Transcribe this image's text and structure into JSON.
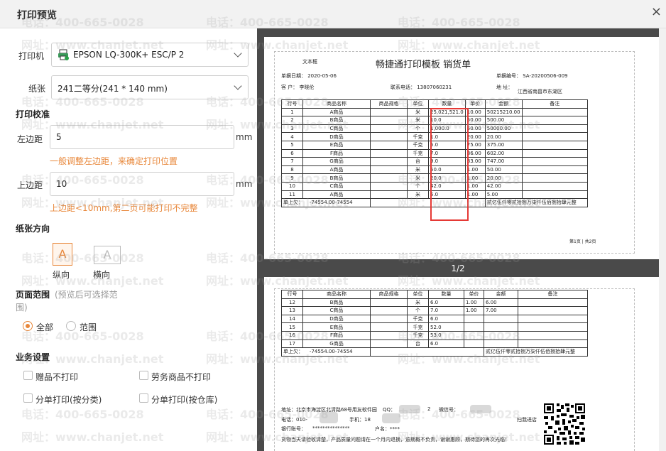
{
  "window": {
    "title": "打印预览",
    "close": "×"
  },
  "watermark": {
    "phone": "电话：400-665-0028",
    "site": "网址：www.chanjet.net"
  },
  "printer": {
    "label": "打印机",
    "value": "EPSON LQ-300K+ ESC/P 2"
  },
  "paper": {
    "label": "纸张",
    "value": "241二等分(241 * 140  mm)"
  },
  "calibration": {
    "title": "打印校准",
    "left_label": "左边距",
    "left_value": "5",
    "left_unit": "mm",
    "left_hint": "一般调整左边距，来确定打印位置",
    "top_label": "上边距",
    "top_value": "10",
    "top_unit": "mm",
    "top_hint": "上边距<10mm,第二页可能打印不完整"
  },
  "orientation": {
    "title": "纸张方向",
    "portrait": "纵向",
    "landscape": "横向",
    "glyph": "A"
  },
  "range": {
    "title": "页面范围",
    "note": "(预览后可选择范围)",
    "all": "全部",
    "custom": "范围"
  },
  "business": {
    "title": "业务设置",
    "no_gift": "赠品不打印",
    "no_service": "劳务商品不打印",
    "split_category": "分单打印(按分类)",
    "split_warehouse": "分单打印(按仓库)"
  },
  "preview": {
    "page_indicator": "1/2",
    "doc_title": "畅捷通打印模板  销货单",
    "tag": "文本框",
    "date": "单据日期： 2020-05-06",
    "customer": "客    户： 李晓伦",
    "phone": "联系电话： 13807060231",
    "bill_no": "单据编号： SA-20200506-009",
    "address": "地  址：",
    "address_value": "江西省南昌市东湖区",
    "headers": [
      "行号",
      "商品名称",
      "商品规格",
      "单位",
      "数量",
      "单价",
      "金额",
      "备注"
    ],
    "rows1": [
      [
        "1",
        "A商品",
        "",
        "米",
        "25,021,521.0",
        "10.00",
        "50215210.00"
      ],
      [
        "2",
        "B商品",
        "",
        "米",
        "10.0",
        "50.00",
        "500.00"
      ],
      [
        "3",
        "C商品",
        "",
        "个",
        "1,000.0",
        "50.00",
        "50000.00"
      ],
      [
        "4",
        "D商品",
        "",
        "千克",
        "1.0",
        "20.00",
        "20.00"
      ],
      [
        "5",
        "E商品",
        "",
        "千克",
        "5.0",
        "75.00",
        "375.00"
      ],
      [
        "6",
        "F商品",
        "",
        "千克",
        "7.0",
        "86.00",
        "602.00"
      ],
      [
        "7",
        "G商品",
        "",
        "台",
        "9.0",
        "83.00",
        "747.00"
      ],
      [
        "8",
        "A商品",
        "",
        "米",
        "50.0",
        "1.00",
        "50.00"
      ],
      [
        "9",
        "B商品",
        "",
        "米",
        "20.0",
        "1.00",
        "20.00"
      ],
      [
        "10",
        "C商品",
        "",
        "个",
        "42.0",
        "1.00",
        "42.00"
      ],
      [
        "11",
        "A商品",
        "",
        "米",
        "5.0",
        "1.00",
        "5.00"
      ]
    ],
    "rows2": [
      [
        "12",
        "B商品",
        "",
        "米",
        "6.0",
        "1.00",
        "6.00"
      ],
      [
        "13",
        "C商品",
        "",
        "个",
        "7.0",
        "1.00",
        "7.00"
      ],
      [
        "14",
        "D商品",
        "",
        "千克",
        "6.0",
        "",
        ""
      ],
      [
        "15",
        "E商品",
        "",
        "千克",
        "52.0",
        "",
        ""
      ],
      [
        "16",
        "F商品",
        "",
        "千克",
        "53.0",
        "",
        ""
      ],
      [
        "17",
        "G商品",
        "",
        "台",
        "6.0",
        "",
        ""
      ]
    ],
    "total_label": "单上欠：",
    "total_value": "-74554.00-74554",
    "total_words": "贰亿伍仟零贰拾捌万柒仟伍佰捌拾肆元整",
    "page_footer": "第1页 | 共2页",
    "addr_line": "地址：北京市海淀区北清路68号用友软件园",
    "qq": "QQ：",
    "qq_tail": "2",
    "wechat": "微信号：",
    "tel": "电话：010-",
    "mobile": "手机：18",
    "bank": "银行账号：",
    "bank_mask": "***************",
    "account_name": "户名：****",
    "scan": "扫我进店",
    "notice": "货物当天请验收清楚，产品质量问题请在一个月内退换，逾期概不负责，谢谢惠顾，期待您的再次光临！"
  }
}
